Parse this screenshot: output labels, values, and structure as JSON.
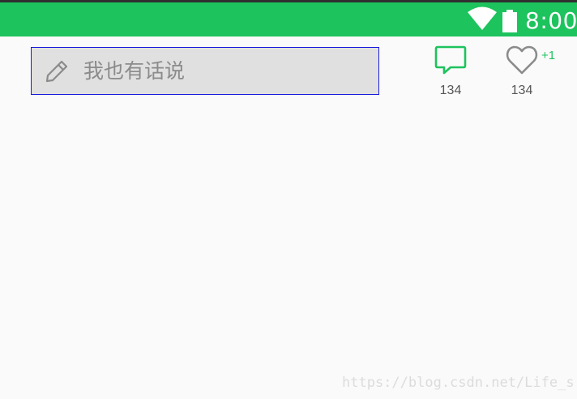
{
  "status_bar": {
    "time": "8:00",
    "background_color": "#1dc35d",
    "icons": [
      "wifi-icon",
      "battery-icon"
    ]
  },
  "comment_input": {
    "icon": "pencil-icon",
    "placeholder": "我也有话说",
    "background_color": "#e0e0e0",
    "border_color": "#1a1adb"
  },
  "actions": {
    "comments": {
      "icon": "comment-icon",
      "count": "134",
      "icon_color": "#1dc35d"
    },
    "likes": {
      "icon": "heart-icon",
      "count": "134",
      "increment": "+1",
      "icon_color": "#8b8b8b",
      "increment_color": "#1dc35d"
    }
  },
  "watermark": {
    "text": "https://blog.csdn.net/Life_s"
  }
}
